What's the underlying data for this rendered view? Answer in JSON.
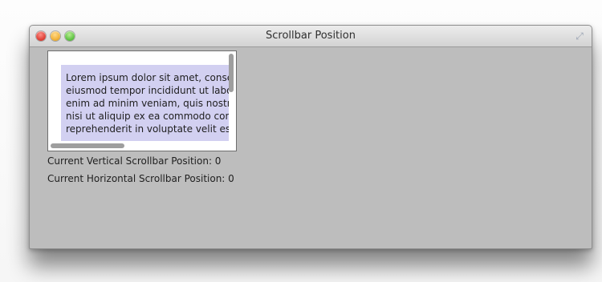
{
  "window": {
    "title": "Scrollbar Position"
  },
  "scrollpane": {
    "lines": [
      "Lorem ipsum dolor sit amet, consectetur adipiscing elit, sed do",
      "eiusmod tempor incididunt ut labore et dolore magna aliqua. Ut",
      "enim ad minim veniam, quis nostrud exercitation ullamco laboris",
      "nisi ut aliquip ex ea commodo consequat. Duis aute irure dolor in",
      "reprehenderit in voluptate velit esse cillum dolore eu fugiat"
    ]
  },
  "status": {
    "vertical": "Current Vertical Scrollbar Position: 0",
    "horizontal": "Current Horizontal Scrollbar Position: 0"
  },
  "icons": {
    "close": "close-light",
    "minimize": "minimize-light",
    "zoom": "zoom-light",
    "fullscreen": "fullscreen-icon"
  },
  "colors": {
    "text_highlight": "#d2d0f1",
    "window_background": "#bdbdbd"
  }
}
